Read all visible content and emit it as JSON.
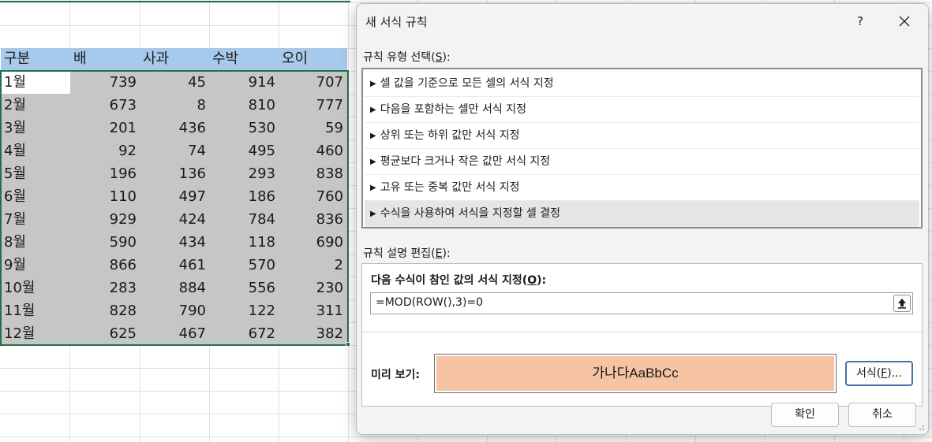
{
  "sheet": {
    "headers": [
      "구분",
      "배",
      "사과",
      "수박",
      "오이"
    ],
    "rows": [
      [
        "1월",
        "739",
        "45",
        "914",
        "707"
      ],
      [
        "2월",
        "673",
        "8",
        "810",
        "777"
      ],
      [
        "3월",
        "201",
        "436",
        "530",
        "59"
      ],
      [
        "4월",
        "92",
        "74",
        "495",
        "460"
      ],
      [
        "5월",
        "196",
        "136",
        "293",
        "838"
      ],
      [
        "6월",
        "110",
        "497",
        "186",
        "760"
      ],
      [
        "7월",
        "929",
        "424",
        "784",
        "836"
      ],
      [
        "8월",
        "590",
        "434",
        "118",
        "690"
      ],
      [
        "9월",
        "866",
        "461",
        "570",
        "2"
      ],
      [
        "10월",
        "283",
        "884",
        "556",
        "230"
      ],
      [
        "11월",
        "828",
        "790",
        "122",
        "311"
      ],
      [
        "12월",
        "625",
        "467",
        "672",
        "382"
      ]
    ],
    "colors": {
      "header_fill": "#a6c9ec",
      "selection_fill": "#c6c6c6",
      "selection_border": "#217346"
    }
  },
  "dialog": {
    "title": "새 서식 규칙",
    "help_label": "?",
    "close_icon": "close-icon",
    "rule_type_label": "규칙 유형 선택(",
    "rule_type_key": "S",
    "rule_type_label_end": "):",
    "rule_types": [
      "셀 값을 기준으로 모든 셀의 서식 지정",
      "다음을 포함하는 셀만 서식 지정",
      "상위 또는 하위 값만 서식 지정",
      "평균보다 크거나 작은 값만 서식 지정",
      "고유 또는 중복 값만 서식 지정",
      "수식을 사용하여 서식을 지정할 셀 결정"
    ],
    "selected_rule_index": 5,
    "edit_label": "규칙 설명 편집(",
    "edit_key": "E",
    "edit_label_end": "):",
    "formula_label": "다음 수식이 참인 값의 서식 지정(",
    "formula_key": "O",
    "formula_label_end": "):",
    "formula_value": "=MOD(ROW(),3)=0",
    "preview_label": "미리 보기:",
    "preview_text": "가나다AaBbCc",
    "preview_fill": "#f6c3a4",
    "format_button": "서식(",
    "format_key": "F",
    "format_button_end": ")...",
    "ok_button": "확인",
    "cancel_button": "취소"
  }
}
